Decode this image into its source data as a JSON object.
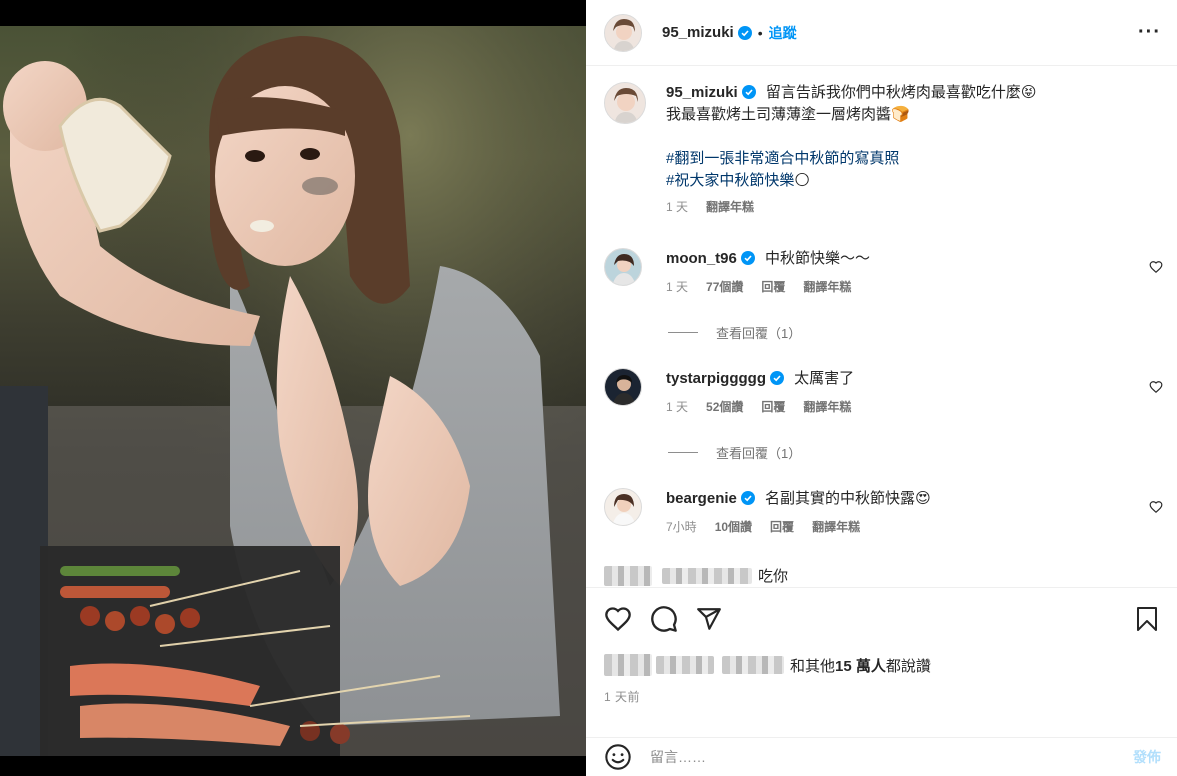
{
  "header": {
    "username": "95_mizuki",
    "dot": "•",
    "follow_label": "追蹤",
    "more_label": "···"
  },
  "caption": {
    "username": "95_mizuki",
    "line1": "留言告訴我你們中秋烤肉最喜歡吃什麼",
    "line1_emoji": "😝",
    "line2": "我最喜歡烤土司薄薄塗一層烤肉醬",
    "line2_emoji": "🍞",
    "tag1": "#翻到一張非常適合中秋節的寫真照",
    "tag2": "#祝大家中秋節快樂",
    "tag2_emoji": "🌕",
    "time": "1 天",
    "translate": "翻譯年糕"
  },
  "comments": [
    {
      "username": "moon_t96",
      "text": "中秋節快樂～～",
      "time": "1 天",
      "likes": "77個讚",
      "reply": "回覆",
      "translate": "翻譯年糕",
      "view_replies": "查看回覆（1）"
    },
    {
      "username": "tystarpiggggg",
      "text": "太厲害了",
      "time": "1 天",
      "likes": "52個讚",
      "reply": "回覆",
      "translate": "翻譯年糕",
      "view_replies": "查看回覆（1）"
    },
    {
      "username": "beargenie",
      "text": "名副其實的中秋節快露",
      "emoji": "😍",
      "time": "7小時",
      "likes": "10個讚",
      "reply": "回覆",
      "translate": "翻譯年糕"
    },
    {
      "text": "吃你"
    }
  ],
  "likes_text": "和其他",
  "likes_count": "15 萬人",
  "likes_suffix": "都說讚",
  "date": "1 天前",
  "comment_input": {
    "placeholder": "留言……",
    "post_label": "發佈"
  },
  "colors": {
    "accent": "#0095f6",
    "tag": "#00376b",
    "muted": "#8e8e8e",
    "verified": "#0095f6"
  }
}
